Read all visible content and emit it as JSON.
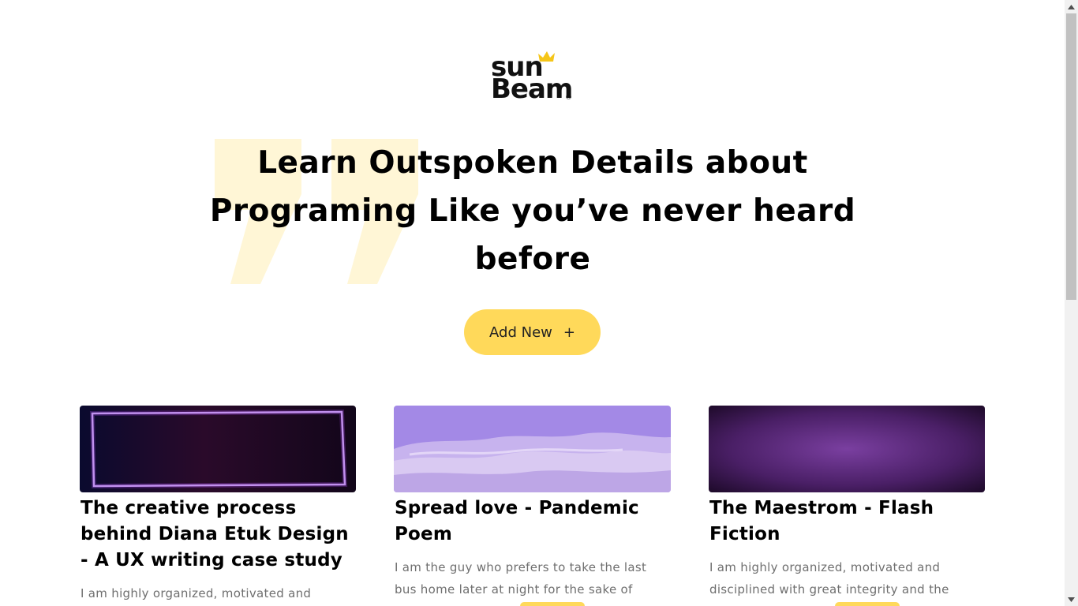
{
  "brand": {
    "line1": "sun",
    "line2": "Beam",
    "reg_mark": "®"
  },
  "hero": {
    "title": "Learn Outspoken Details about Programing Like you’ve never heard before",
    "add_button_label": "Add New",
    "add_button_icon": "+"
  },
  "colors": {
    "accent": "#ffd95a",
    "quote_mark": "#fff6d6"
  },
  "cards": [
    {
      "title": "The creative process behind Diana Etuk Design - A UX writing case study",
      "excerpt": "I am highly organized, motivated and disciplined with great integrity and the"
    },
    {
      "title": "Spread love - Pandemic Poem",
      "excerpt": "I am the guy who prefers to take the last bus home later at night for the sake of solitude. Looking ..."
    },
    {
      "title": "The Maestrom - Flash Fiction",
      "excerpt": "I am highly organized, motivated and disciplined with great integrity and the ability to work und..."
    }
  ]
}
